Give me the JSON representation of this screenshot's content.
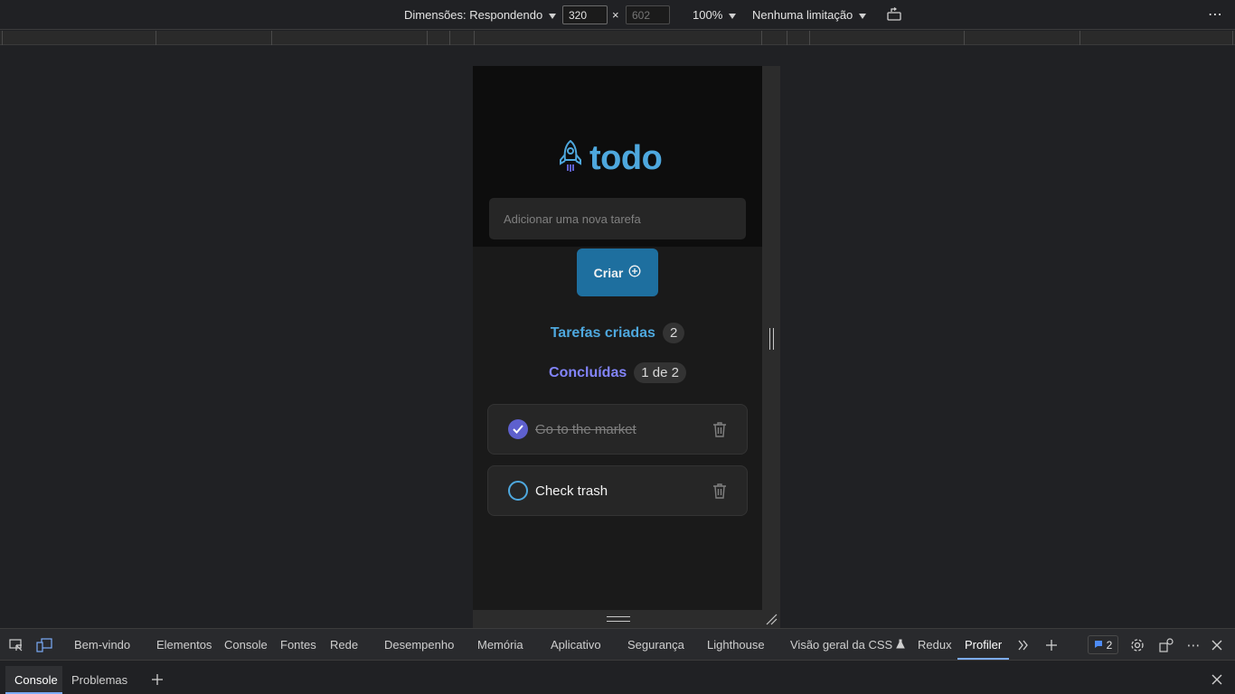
{
  "device_toolbar": {
    "dimensions_label": "Dimensões: Respondendo",
    "width_value": "320",
    "height_placeholder": "602",
    "times": "×",
    "zoom": "100%",
    "throttling": "Nenhuma limitação",
    "more": "⋯"
  },
  "app": {
    "brand": "todo",
    "input_placeholder": "Adicionar uma nova tarefa",
    "create_label": "Criar",
    "created_label": "Tarefas criadas",
    "created_count": "2",
    "done_label": "Concluídas",
    "done_count": "1 de 2",
    "tasks": [
      {
        "text": "Go to the market",
        "done": true
      },
      {
        "text": "Check trash",
        "done": false
      }
    ],
    "colors": {
      "blue": "#4ea8de",
      "purple": "#8284fa",
      "button": "#1e6f9f"
    }
  },
  "devtools": {
    "tabs": [
      "Bem-vindo",
      "Elementos",
      "Console",
      "Fontes",
      "Rede",
      "Desempenho",
      "Memória",
      "Aplicativo",
      "Segurança",
      "Lighthouse",
      "Visão geral da CSS",
      "Redux",
      "Profiler"
    ],
    "active_tab": "Profiler",
    "issues_count": "2",
    "drawer_tabs": [
      "Console",
      "Problemas"
    ]
  }
}
